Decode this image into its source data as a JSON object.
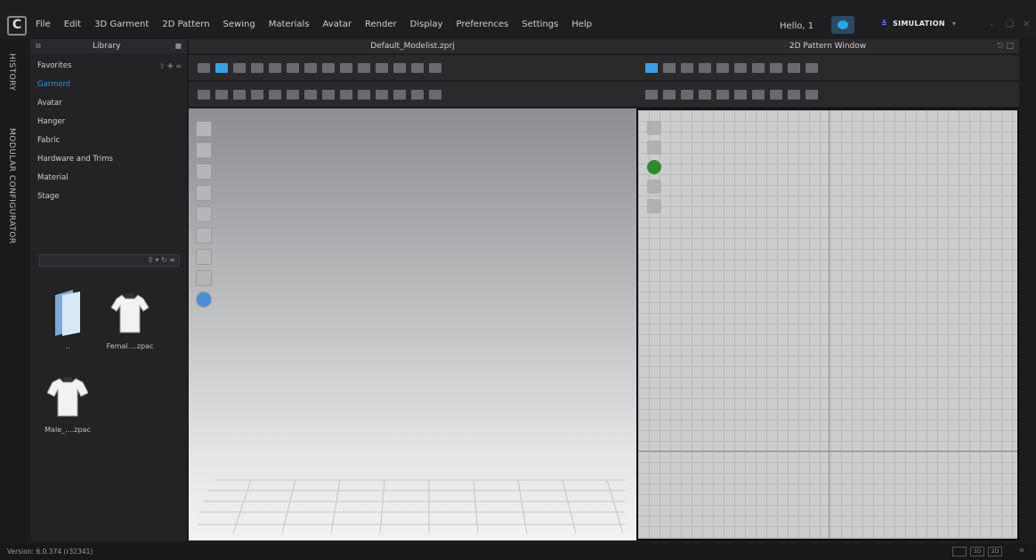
{
  "app": {
    "logo_letter": "C",
    "menu": [
      "File",
      "Edit",
      "3D Garment",
      "2D Pattern",
      "Sewing",
      "Materials",
      "Avatar",
      "Render",
      "Display",
      "Preferences",
      "Settings",
      "Help"
    ],
    "greeting": "Hello, 1",
    "mode": "SIMULATION"
  },
  "side_tabs": [
    "HISTORY",
    "MODULAR CONFIGURATOR"
  ],
  "library": {
    "title": "Library",
    "items": [
      {
        "label": "Favorites",
        "active": false
      },
      {
        "label": "Garment",
        "active": true
      },
      {
        "label": "Avatar",
        "active": false
      },
      {
        "label": "Hanger",
        "active": false
      },
      {
        "label": "Fabric",
        "active": false
      },
      {
        "label": "Hardware and Trims",
        "active": false
      },
      {
        "label": "Material",
        "active": false
      },
      {
        "label": "Stage",
        "active": false
      }
    ],
    "search_placeholder": "",
    "thumbnails": [
      {
        "caption": "..",
        "icon": "folder-icon"
      },
      {
        "caption": "Femal....zpac",
        "icon": "tshirt-icon"
      },
      {
        "caption": "Male_....zpac",
        "icon": "tshirt-icon"
      }
    ]
  },
  "viewport3d": {
    "title": "Default_Modelist.zprj"
  },
  "pattern2d": {
    "title": "2D Pattern Window"
  },
  "status": {
    "version": "Version: 6.0.374 (r32341)",
    "view_buttons": [
      "",
      "3D",
      "2D"
    ]
  },
  "colors": {
    "accent": "#2f8fd1",
    "background": "#1c1c1e",
    "panel": "#232326"
  }
}
